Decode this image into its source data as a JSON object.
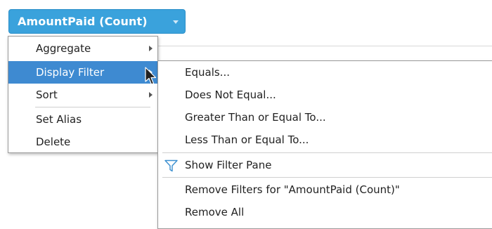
{
  "field_pill": {
    "label": "AmountPaid (Count)",
    "dropdown_icon": "caret-down-icon"
  },
  "context_menu": {
    "items": [
      {
        "label": "Aggregate",
        "has_submenu": true
      },
      {
        "label": "Display Filter",
        "has_submenu": true,
        "highlighted": true
      },
      {
        "label": "Sort",
        "has_submenu": true
      },
      {
        "label": "Set Alias"
      },
      {
        "label": "Delete"
      }
    ]
  },
  "display_filter_submenu": {
    "items": [
      {
        "label": "Equals..."
      },
      {
        "label": "Does Not Equal..."
      },
      {
        "label": "Greater Than or Equal To..."
      },
      {
        "label": "Less Than or Equal To..."
      },
      {
        "label": "Show Filter Pane",
        "icon": "filter-funnel-icon"
      },
      {
        "label": "Remove Filters for \"AmountPaid (Count)\""
      },
      {
        "label": "Remove All"
      }
    ]
  },
  "colors": {
    "pill_bg": "#3aa2dc",
    "highlight_bg": "#3e8ad1",
    "funnel_icon": "#3a8fd0"
  }
}
